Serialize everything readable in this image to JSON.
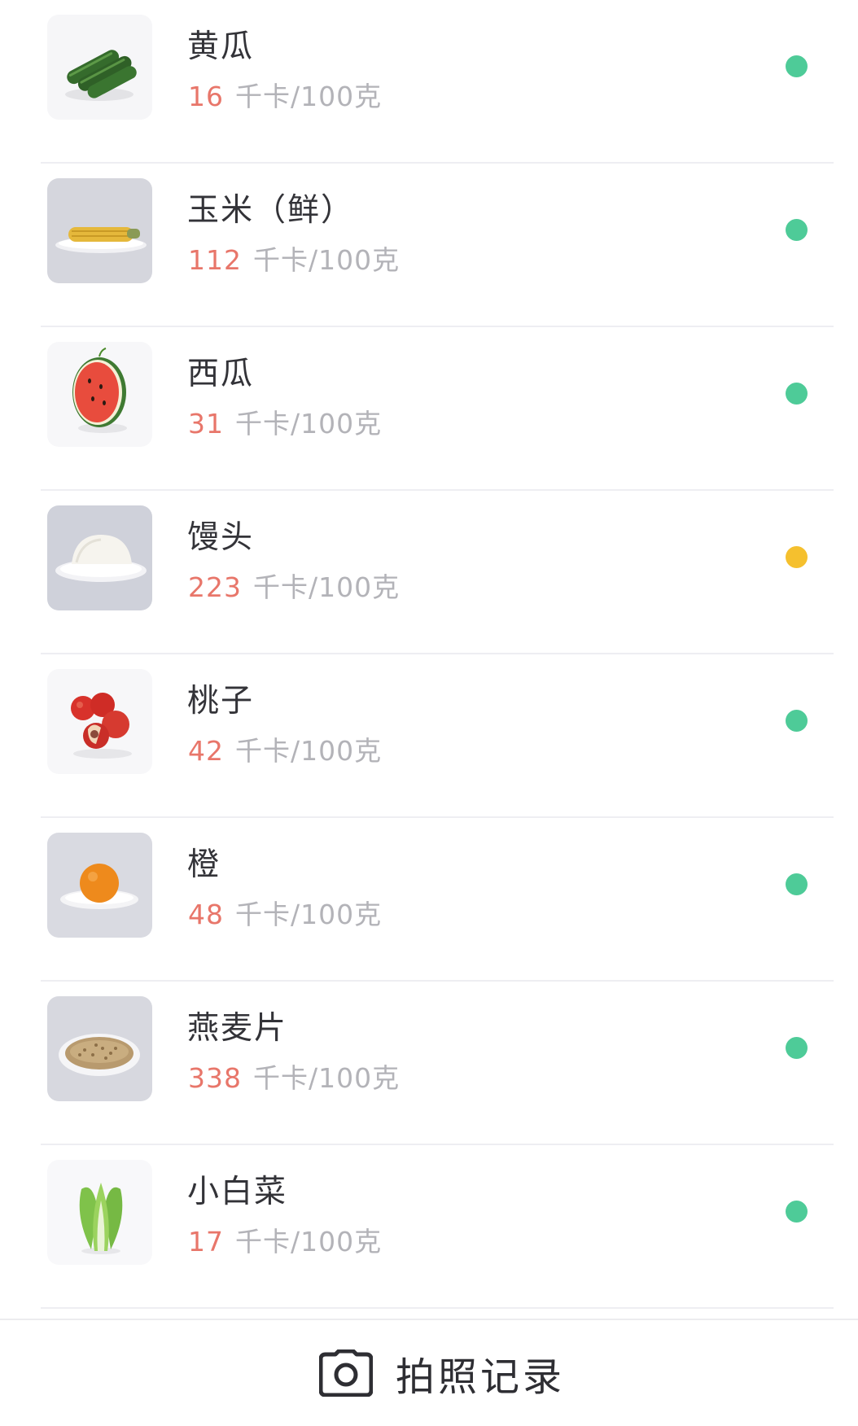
{
  "foods": [
    {
      "name": "黄瓜",
      "calories": "16",
      "unit": "千卡/100克",
      "status_color": "#4ecb98",
      "icon": "cucumber-icon"
    },
    {
      "name": "玉米（鲜）",
      "calories": "112",
      "unit": "千卡/100克",
      "status_color": "#4ecb98",
      "icon": "corn-icon"
    },
    {
      "name": "西瓜",
      "calories": "31",
      "unit": "千卡/100克",
      "status_color": "#4ecb98",
      "icon": "watermelon-icon"
    },
    {
      "name": "馒头",
      "calories": "223",
      "unit": "千卡/100克",
      "status_color": "#f5c02e",
      "icon": "steamed-bun-icon"
    },
    {
      "name": "桃子",
      "calories": "42",
      "unit": "千卡/100克",
      "status_color": "#4ecb98",
      "icon": "peach-icon"
    },
    {
      "name": "橙",
      "calories": "48",
      "unit": "千卡/100克",
      "status_color": "#4ecb98",
      "icon": "orange-icon"
    },
    {
      "name": "燕麦片",
      "calories": "338",
      "unit": "千卡/100克",
      "status_color": "#4ecb98",
      "icon": "oatmeal-icon"
    },
    {
      "name": "小白菜",
      "calories": "17",
      "unit": "千卡/100克",
      "status_color": "#4ecb98",
      "icon": "bok-choy-icon"
    }
  ],
  "bottom_bar": {
    "photo_label": "拍照记录",
    "icon": "camera-icon"
  }
}
